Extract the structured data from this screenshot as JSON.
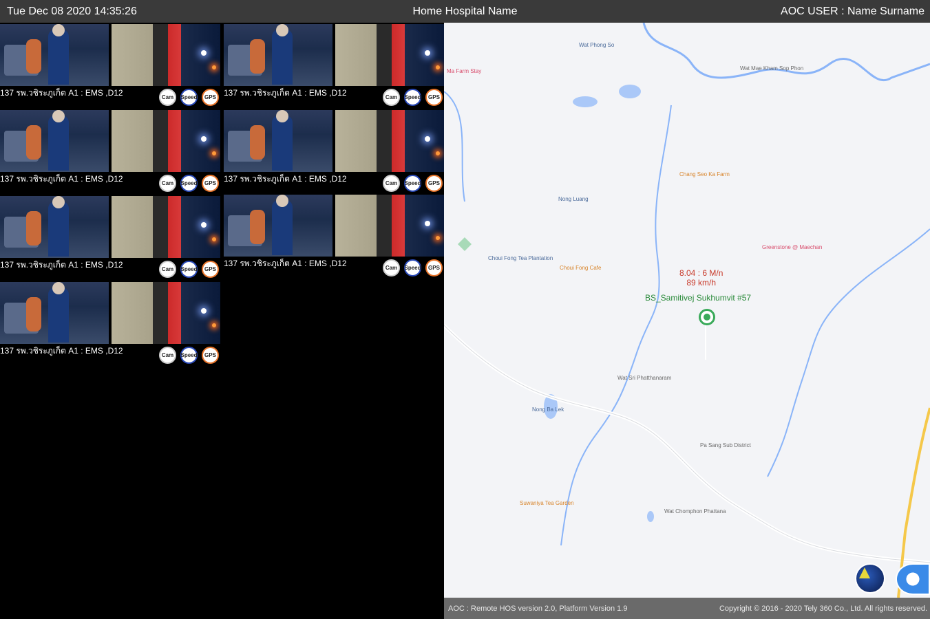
{
  "header": {
    "datetime": "Tue Dec 08 2020 14:35:26",
    "hospital": "Home Hospital Name",
    "user": "AOC USER : Name Surname"
  },
  "cameras": [
    {
      "label": "137 รพ.วชิระภูเก็ต A1 : EMS ,D12",
      "icons": [
        "Cam",
        "Speed",
        "GPS"
      ]
    },
    {
      "label": "137 รพ.วชิระภูเก็ต A1 : EMS ,D12",
      "icons": [
        "Cam",
        "Speed",
        "GPS"
      ]
    },
    {
      "label": "137 รพ.วชิระภูเก็ต A1 : EMS ,D12",
      "icons": [
        "Cam",
        "Speed",
        "GPS"
      ]
    },
    {
      "label": "137 รพ.วชิระภูเก็ต A1 : EMS ,D12",
      "icons": [
        "Cam",
        "Speed",
        "GPS"
      ]
    },
    {
      "label": "137 รพ.วชิระภูเก็ต A1 : EMS ,D12",
      "icons": [
        "Cam",
        "Speed",
        "GPS"
      ]
    },
    {
      "label": "137 รพ.วชิระภูเก็ต A1 : EMS ,D12",
      "icons": [
        "Cam",
        "Speed",
        "GPS"
      ]
    },
    {
      "label": "137 รพ.วชิระภูเก็ต A1 : EMS ,D12",
      "icons": [
        "Cam",
        "Speed",
        "GPS"
      ]
    }
  ],
  "map": {
    "vehicle_eta": "8.04 : 6 M/n",
    "vehicle_speed": "89 km/h",
    "vehicle_name": "BS_Samitivej Sukhumvit #57",
    "places": [
      "Wat Phong So",
      "Wat Mae Kham Sop Phon",
      "Ma Farm Stay",
      "Choui Fong Tea Plantation",
      "Choui Fong Cafe",
      "Nong Luang",
      "Wat Sri Phatthanaram",
      "Nong Ba Lek",
      "Suwaniya Tea Garden",
      "Wat Chomphon Phattana",
      "Greenstone @ Maechan",
      "Chang Seo Ka Farm",
      "Pa Sang Sub District"
    ]
  },
  "footer": {
    "version": "AOC : Remote HOS version 2.0, Platform Version 1.9",
    "copyright": "Copyright © 2016 - 2020 Tely 360 Co., Ltd. All rights reserved."
  },
  "colors": {
    "topbar": "#3a3a3a",
    "footer": "#6a6a6a",
    "vehicle_text": "#c83a2a",
    "vehicle_name": "#2a8a3a"
  }
}
